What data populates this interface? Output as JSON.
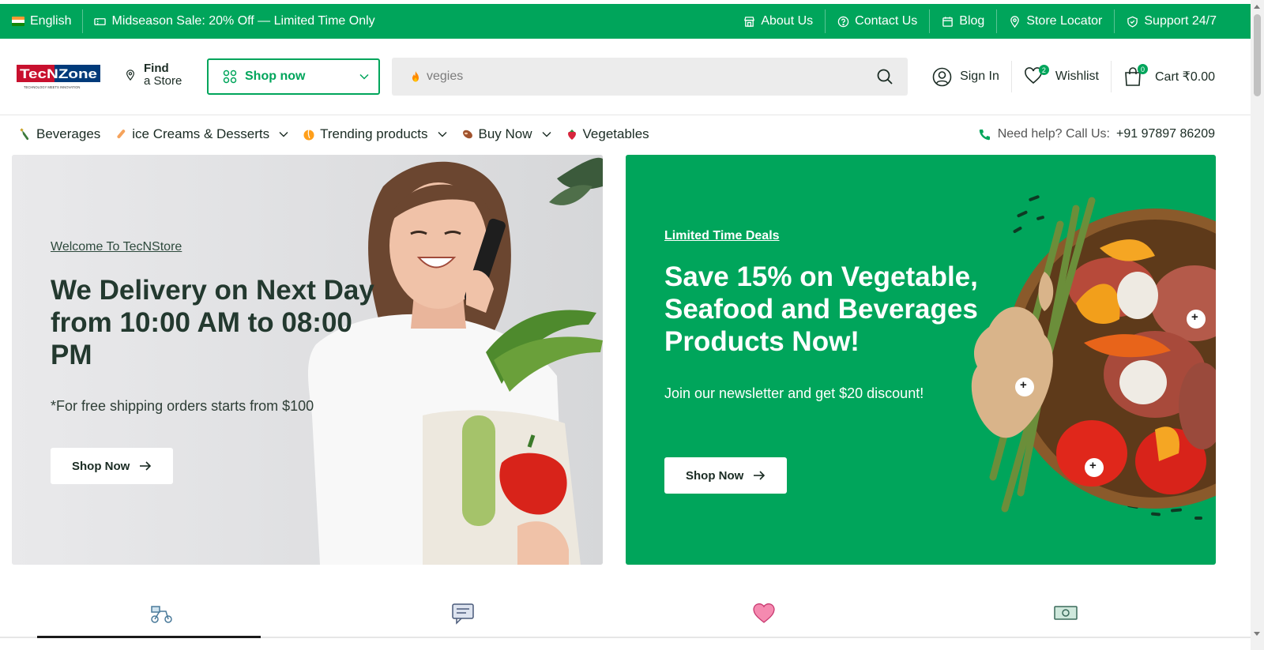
{
  "topbar": {
    "language": "English",
    "promo": "Midseason Sale: 20% Off — Limited Time Only",
    "links": [
      {
        "label": "About Us",
        "icon": "store-icon"
      },
      {
        "label": "Contact Us",
        "icon": "help-circle-icon"
      },
      {
        "label": "Blog",
        "icon": "calendar-icon"
      },
      {
        "label": "Store Locator",
        "icon": "location-pin-icon"
      },
      {
        "label": "Support 24/7",
        "icon": "shield-icon"
      }
    ]
  },
  "header": {
    "logo_text": "TecNZone",
    "logo_tagline": "TECHNOLOGY MEETS INNOVATION",
    "find_line1": "Find",
    "find_line2": "a Store",
    "shop_select": "Shop now",
    "search_placeholder": "vegies",
    "sign_in": "Sign In",
    "wishlist": "Wishlist",
    "wishlist_count": "2",
    "cart": "Cart ₹0.00",
    "cart_count": "0"
  },
  "nav": {
    "items": [
      {
        "label": "Beverages",
        "dropdown": false
      },
      {
        "label": "ice Creams & Desserts",
        "dropdown": true
      },
      {
        "label": "Trending products",
        "dropdown": true
      },
      {
        "label": "Buy Now",
        "dropdown": true
      },
      {
        "label": "Vegetables",
        "dropdown": false
      }
    ],
    "help": "Need help? Call Us:",
    "phone": "+91 97897 86209"
  },
  "hero_left": {
    "eyebrow": "Welcome To TecNStore",
    "title": "We Delivery on Next Day from 10:00 AM to 08:00 PM",
    "subtitle": "*For free shipping orders starts from $100",
    "button": "Shop Now"
  },
  "hero_right": {
    "eyebrow": "Limited Time Deals",
    "title": "Save 15% on Vegetable, Seafood and Beverages Products Now!",
    "subtitle": "Join our newsletter and get $20 discount!",
    "button": "Shop Now",
    "hotspot": "+"
  },
  "colors": {
    "accent": "#00a55b",
    "text_dark": "#23392f"
  }
}
